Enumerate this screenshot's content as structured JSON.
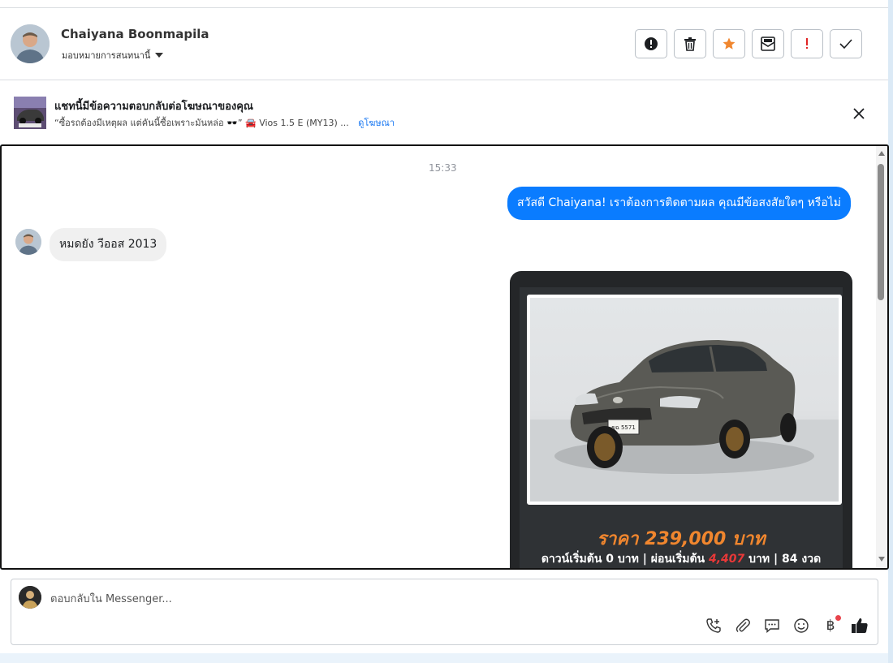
{
  "header": {
    "contact_name": "Chaiyana Boonmapila",
    "assign_label": "มอบหมายการสนทนานี้",
    "actions": [
      {
        "icon": "exclamation-circle-icon"
      },
      {
        "icon": "trash-icon"
      },
      {
        "icon": "star-icon",
        "color": "#f0862e"
      },
      {
        "icon": "mark-unread-icon"
      },
      {
        "icon": "exclamation-icon",
        "color": "#e02424"
      },
      {
        "icon": "check-icon"
      }
    ]
  },
  "ad_banner": {
    "title": "แชทนี้มีข้อความตอบกลับต่อโฆษณาของคุณ",
    "subtitle": "“ซื้อรถต้องมีเหตุผล แต่คันนี้ซื้อเพราะมันหล่อ 🕶️” 🚘 Vios 1.5 E (MY13) ...",
    "link": "ดูโฆษณา"
  },
  "conversation": {
    "timestamp": "15:33",
    "outgoing_message": "สวัสดี Chaiyana! เราต้องการติดตามผล คุณมีข้อสงสัยใดๆ หรือไม่",
    "incoming_message": "หมดยัง วีออส 2013",
    "car_card": {
      "plate": "ขฉ 5571",
      "price": "ราคา 239,000 บาท",
      "down_prefix": "ดาวน์เริ่มต้น 0 บาท | ผ่อนเริ่มต้น ",
      "installment": "4,407",
      "down_suffix": " บาท | 84 งวด"
    }
  },
  "composer": {
    "placeholder": "ตอบกลับใน Messenger...",
    "baht_symbol": "฿",
    "icons": [
      "add-call-icon",
      "attachment-icon",
      "saved-replies-icon",
      "emoji-icon",
      "payment-icon",
      "like-icon"
    ]
  },
  "colors": {
    "accent": "#0a7cff",
    "price": "#f0862e",
    "installment": "#e83838"
  }
}
